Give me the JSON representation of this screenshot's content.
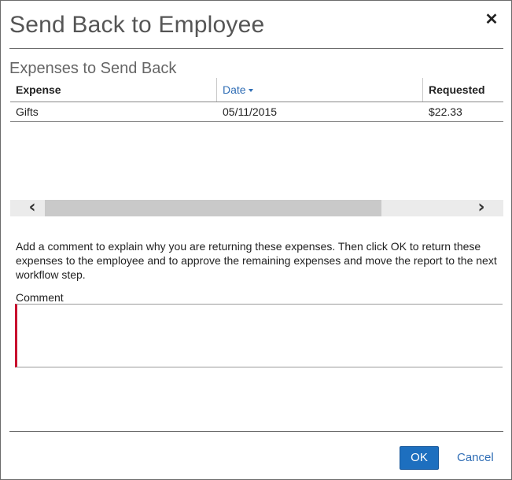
{
  "dialog": {
    "title": "Send Back to Employee",
    "close_symbol": "✕"
  },
  "expenses": {
    "section_title": "Expenses to Send Back",
    "columns": {
      "expense": "Expense",
      "date": "Date",
      "requested": "Requested"
    },
    "sort_indicator": "caret-down-icon",
    "rows": [
      {
        "expense": "Gifts",
        "date": "05/11/2015",
        "requested": "$22.33"
      }
    ]
  },
  "scrollbar": {
    "left_arrow": "‹",
    "right_arrow": "›"
  },
  "instructions": "Add a comment to explain why you are returning these expenses. Then click OK to return these expenses to the employee and to approve the remaining expenses and move the report to the next workflow step.",
  "comment": {
    "label": "Comment",
    "value": "",
    "required_color": "#c8102e"
  },
  "footer": {
    "ok_label": "OK",
    "cancel_label": "Cancel"
  }
}
